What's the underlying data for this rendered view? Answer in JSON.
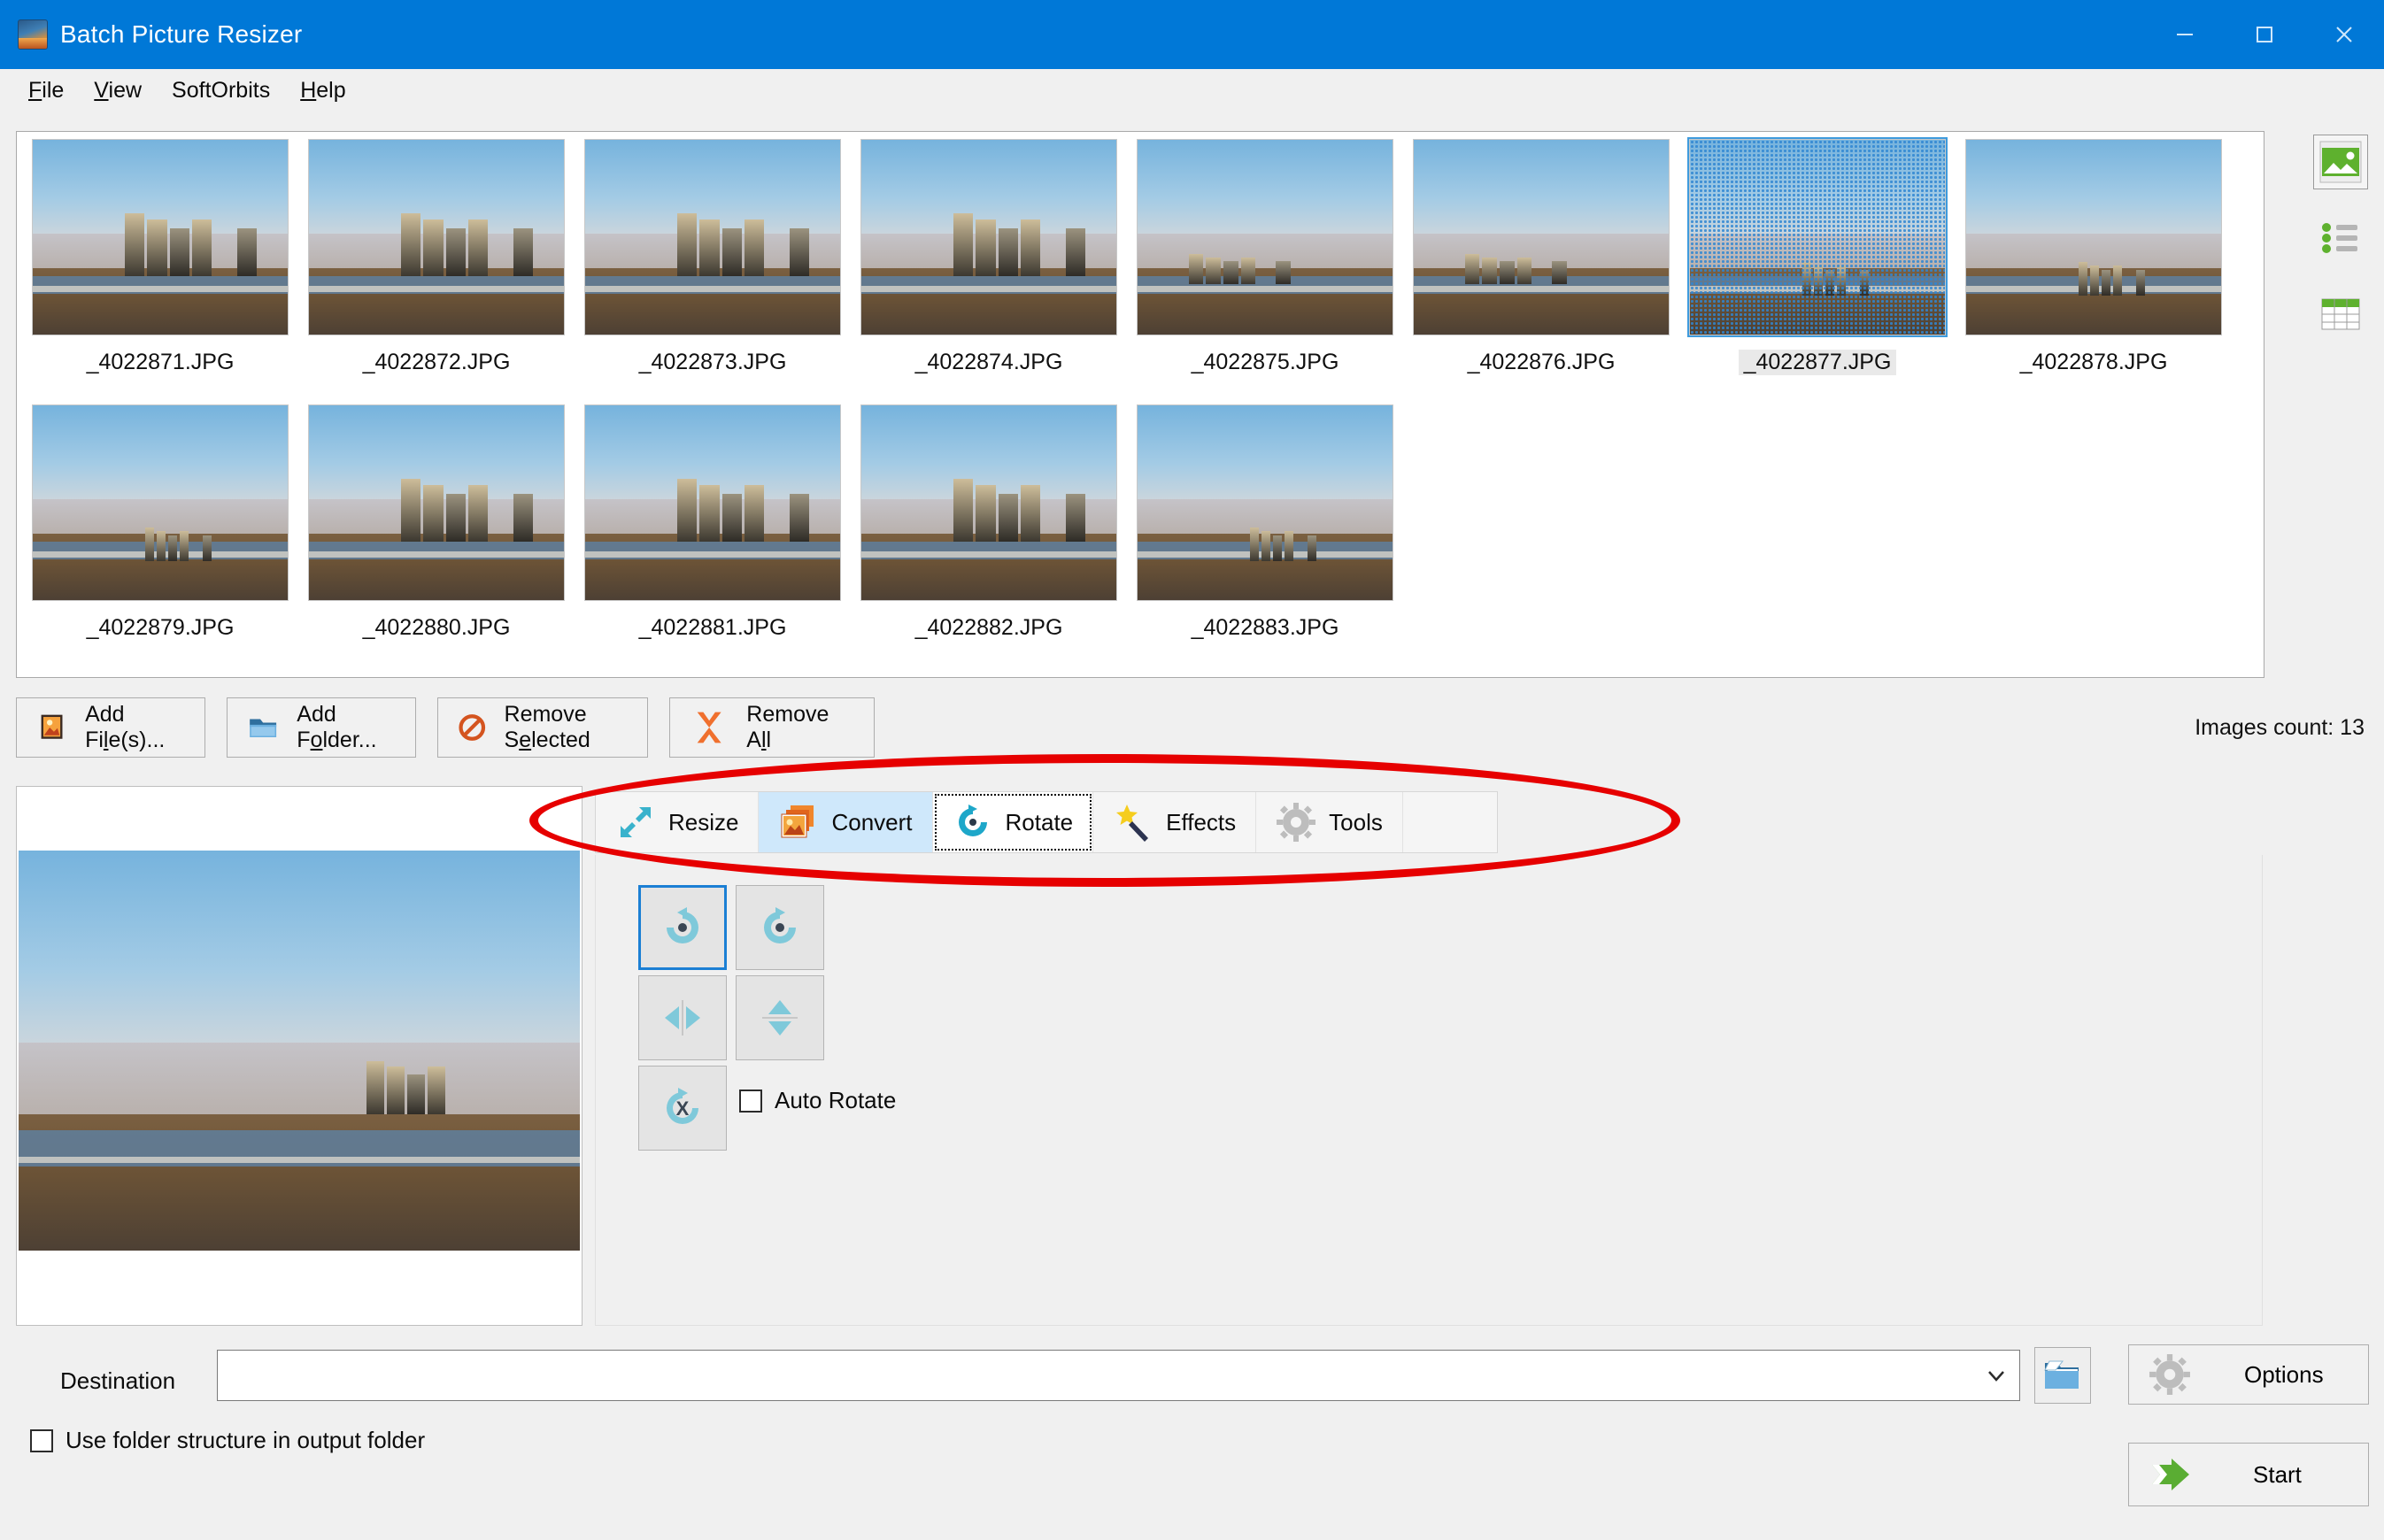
{
  "window": {
    "title": "Batch Picture Resizer",
    "app_icon": "picture-icon",
    "minimize_label": "Minimize",
    "maximize_label": "Maximize",
    "close_label": "Close"
  },
  "menu": {
    "items": [
      {
        "label": "File",
        "accel": "F"
      },
      {
        "label": "View",
        "accel": "V"
      },
      {
        "label": "SoftOrbits",
        "accel": ""
      },
      {
        "label": "Help",
        "accel": "H"
      }
    ]
  },
  "thumbnails": {
    "selected_index": 6,
    "items": [
      {
        "name": "_4022871.JPG",
        "style": "city"
      },
      {
        "name": "_4022872.JPG",
        "style": "city"
      },
      {
        "name": "_4022873.JPG",
        "style": "city"
      },
      {
        "name": "_4022874.JPG",
        "style": "city"
      },
      {
        "name": "_4022875.JPG",
        "style": "small-town"
      },
      {
        "name": "_4022876.JPG",
        "style": "small-town"
      },
      {
        "name": "_4022877.JPG",
        "style": "wide"
      },
      {
        "name": "_4022878.JPG",
        "style": "wide"
      },
      {
        "name": "_4022879.JPG",
        "style": "wide"
      },
      {
        "name": "_4022880.JPG",
        "style": "city"
      },
      {
        "name": "_4022881.JPG",
        "style": "city"
      },
      {
        "name": "_4022882.JPG",
        "style": "city"
      },
      {
        "name": "_4022883.JPG",
        "style": "wide"
      }
    ]
  },
  "view_modes": [
    {
      "name": "thumbnail-view",
      "icon": "image-icon",
      "active": true
    },
    {
      "name": "list-view",
      "icon": "list-icon",
      "active": false
    },
    {
      "name": "details-view",
      "icon": "table-icon",
      "active": false
    }
  ],
  "actions": {
    "add_files": {
      "label_pre": "Add Fi",
      "accel": "l",
      "label_post": "e(s)...",
      "icon": "picture-icon"
    },
    "add_folder": {
      "label_pre": "Add F",
      "accel": "o",
      "label_post": "lder...",
      "icon": "folder-icon"
    },
    "remove_selected": {
      "label_pre": "Remove S",
      "accel": "e",
      "label_post": "lected",
      "icon": "no-entry-icon"
    },
    "remove_all": {
      "label_pre": "Remove A",
      "accel": "l",
      "label_post": "l",
      "icon": "x-mark-icon"
    },
    "images_count": "Images count: 13"
  },
  "tabs": [
    {
      "label": "Resize",
      "icon": "resize-arrow-icon",
      "state": "normal"
    },
    {
      "label": "Convert",
      "icon": "convert-images-icon",
      "state": "hovered"
    },
    {
      "label": "Rotate",
      "icon": "rotate-icon",
      "state": "active"
    },
    {
      "label": "Effects",
      "icon": "magic-wand-icon",
      "state": "normal"
    },
    {
      "label": "Tools",
      "icon": "gear-icon",
      "state": "normal"
    }
  ],
  "rotate_panel": {
    "buttons": [
      {
        "name": "rotate-left-button",
        "icon": "rotate-ccw-icon",
        "selected": true
      },
      {
        "name": "rotate-right-button",
        "icon": "rotate-cw-icon",
        "selected": false
      },
      {
        "name": "flip-horizontal-button",
        "icon": "flip-horizontal-icon",
        "selected": false
      },
      {
        "name": "flip-vertical-button",
        "icon": "flip-vertical-icon",
        "selected": false
      },
      {
        "name": "no-rotation-button",
        "icon": "rotate-none-icon",
        "selected": false
      }
    ],
    "auto_rotate": {
      "label": "Auto Rotate",
      "checked": false
    }
  },
  "destination": {
    "label": "Destination",
    "value": "",
    "placeholder": "",
    "dropdown_icon": "chevron-down-icon",
    "browse_icon": "open-folder-icon"
  },
  "use_folder_structure": {
    "label": "Use folder structure in output folder",
    "checked": false
  },
  "bottom_buttons": {
    "options": {
      "label": "Options",
      "icon": "gear-icon"
    },
    "start": {
      "label": "Start",
      "icon": "green-arrow-icon"
    }
  },
  "annotation": {
    "shape": "ellipse",
    "color": "#e60000",
    "target": "tabs"
  },
  "colors": {
    "titlebar": "#0078d7",
    "window_bg": "#f0f0f0",
    "accent_blue": "#1b7fd4",
    "annotation_red": "#e60000",
    "start_green": "#5aad33"
  }
}
